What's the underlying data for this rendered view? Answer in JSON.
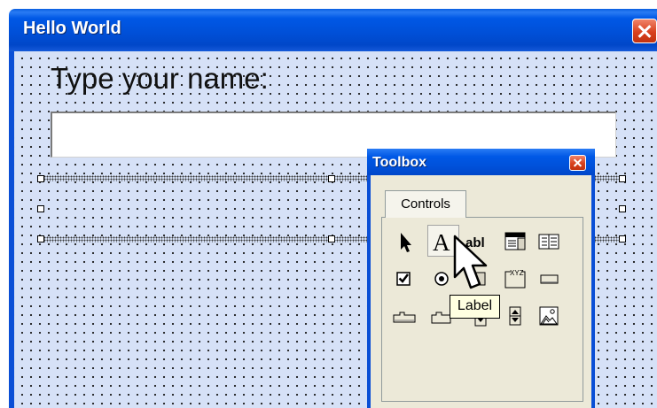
{
  "form": {
    "title": "Hello World",
    "prompt_label": "Type your name:",
    "textbox_value": ""
  },
  "toolbox": {
    "title": "Toolbox",
    "tabs": [
      {
        "label": "Controls",
        "selected": true
      }
    ],
    "tools": [
      {
        "icon": "select-objects-icon"
      },
      {
        "icon": "label-icon",
        "glyph": "A",
        "hovered": true
      },
      {
        "icon": "textbox-icon",
        "glyph": "abl"
      },
      {
        "icon": "combobox-icon"
      },
      {
        "icon": "listbox-icon"
      },
      {
        "icon": "checkbox-icon"
      },
      {
        "icon": "option-button-icon"
      },
      {
        "icon": "toggle-button-icon"
      },
      {
        "icon": "frame-icon",
        "glyph": "XYZ"
      },
      {
        "icon": "command-button-icon"
      },
      {
        "icon": "tabstrip-icon"
      },
      {
        "icon": "multipage-icon"
      },
      {
        "icon": "scrollbar-icon"
      },
      {
        "icon": "spinbutton-icon"
      },
      {
        "icon": "image-icon"
      }
    ],
    "tooltip": "Label"
  },
  "colors": {
    "titlebar_blue": "#0050d8",
    "close_red": "#d8411e",
    "form_background": "#d6e1f7",
    "toolbox_face": "#ece9d8",
    "tooltip_background": "#ffffe1"
  }
}
